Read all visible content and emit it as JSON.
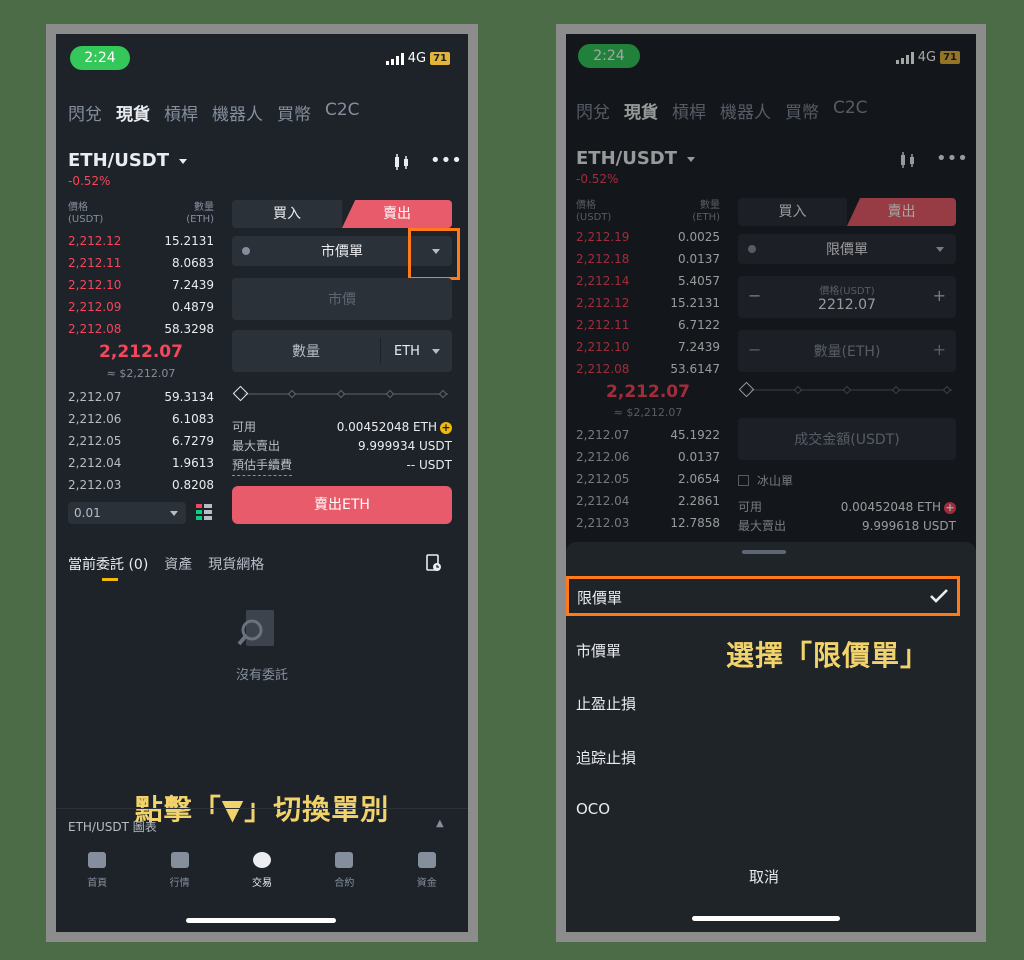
{
  "status": {
    "time": "2:24",
    "network": "4G",
    "battery": "71"
  },
  "nav_tabs": [
    "閃兌",
    "現貨",
    "槓桿",
    "機器人",
    "買幣",
    "C2C"
  ],
  "left": {
    "pair": "ETH/USDT",
    "change": "-0.52%",
    "orderbook": {
      "header_price": "價格",
      "header_price_unit": "(USDT)",
      "header_qty": "數量",
      "header_qty_unit": "(ETH)",
      "asks": [
        {
          "price": "2,212.12",
          "qty": "15.2131"
        },
        {
          "price": "2,212.11",
          "qty": "8.0683"
        },
        {
          "price": "2,212.10",
          "qty": "7.2439"
        },
        {
          "price": "2,212.09",
          "qty": "0.4879"
        },
        {
          "price": "2,212.08",
          "qty": "58.3298"
        }
      ],
      "mid_price": "2,212.07",
      "mid_sub": "≈ $2,212.07",
      "bids": [
        {
          "price": "2,212.07",
          "qty": "59.3134"
        },
        {
          "price": "2,212.06",
          "qty": "6.1083"
        },
        {
          "price": "2,212.05",
          "qty": "6.7279"
        },
        {
          "price": "2,212.04",
          "qty": "1.9613"
        },
        {
          "price": "2,212.03",
          "qty": "0.8208"
        }
      ],
      "depth": "0.01"
    },
    "form": {
      "buy_label": "買入",
      "sell_label": "賣出",
      "order_type": "市價單",
      "price_placeholder": "市價",
      "qty_label": "數量",
      "qty_unit": "ETH",
      "available_label": "可用",
      "available_value": "0.00452048 ETH",
      "max_sell_label": "最大賣出",
      "max_sell_value": "9.999934 USDT",
      "fee_label": "預估手續費",
      "fee_value": "-- USDT",
      "submit": "賣出ETH"
    },
    "lower_tabs": [
      "當前委託 (0)",
      "資產",
      "現貨網格"
    ],
    "empty_text": "沒有委託",
    "chart_bar_label": "ETH/USDT 圖表",
    "caption": "點擊「▼」切換單別",
    "bottom_nav": [
      "首頁",
      "行情",
      "交易",
      "合約",
      "資金"
    ]
  },
  "right": {
    "pair": "ETH/USDT",
    "change": "-0.52%",
    "orderbook": {
      "header_price": "價格",
      "header_price_unit": "(USDT)",
      "header_qty": "數量",
      "header_qty_unit": "(ETH)",
      "asks": [
        {
          "price": "2,212.19",
          "qty": "0.0025"
        },
        {
          "price": "2,212.18",
          "qty": "0.0137"
        },
        {
          "price": "2,212.14",
          "qty": "5.4057"
        },
        {
          "price": "2,212.12",
          "qty": "15.2131"
        },
        {
          "price": "2,212.11",
          "qty": "6.7122"
        },
        {
          "price": "2,212.10",
          "qty": "7.2439"
        },
        {
          "price": "2,212.08",
          "qty": "53.6147"
        }
      ],
      "mid_price": "2,212.07",
      "mid_sub": "≈ $2,212.07",
      "bids": [
        {
          "price": "2,212.07",
          "qty": "45.1922"
        },
        {
          "price": "2,212.06",
          "qty": "0.0137"
        },
        {
          "price": "2,212.05",
          "qty": "2.0654"
        },
        {
          "price": "2,212.04",
          "qty": "2.2861"
        },
        {
          "price": "2,212.03",
          "qty": "12.7858"
        }
      ]
    },
    "form": {
      "buy_label": "買入",
      "sell_label": "賣出",
      "order_type": "限價單",
      "price_label": "價格(USDT)",
      "price_value": "2212.07",
      "qty_placeholder": "數量(ETH)",
      "total_placeholder": "成交金額(USDT)",
      "iceberg_label": "冰山單",
      "available_label": "可用",
      "available_value": "0.00452048 ETH",
      "max_sell_label": "最大賣出",
      "max_sell_value": "9.999618 USDT"
    },
    "sheet_options": [
      "限價單",
      "市價單",
      "止盈止損",
      "追踪止損",
      "OCO"
    ],
    "cancel": "取消",
    "caption": "選擇「限價單」"
  },
  "colors": {
    "accent_red": "#f6465d",
    "highlight": "#ff7a1a",
    "caption": "#f2d36b"
  }
}
